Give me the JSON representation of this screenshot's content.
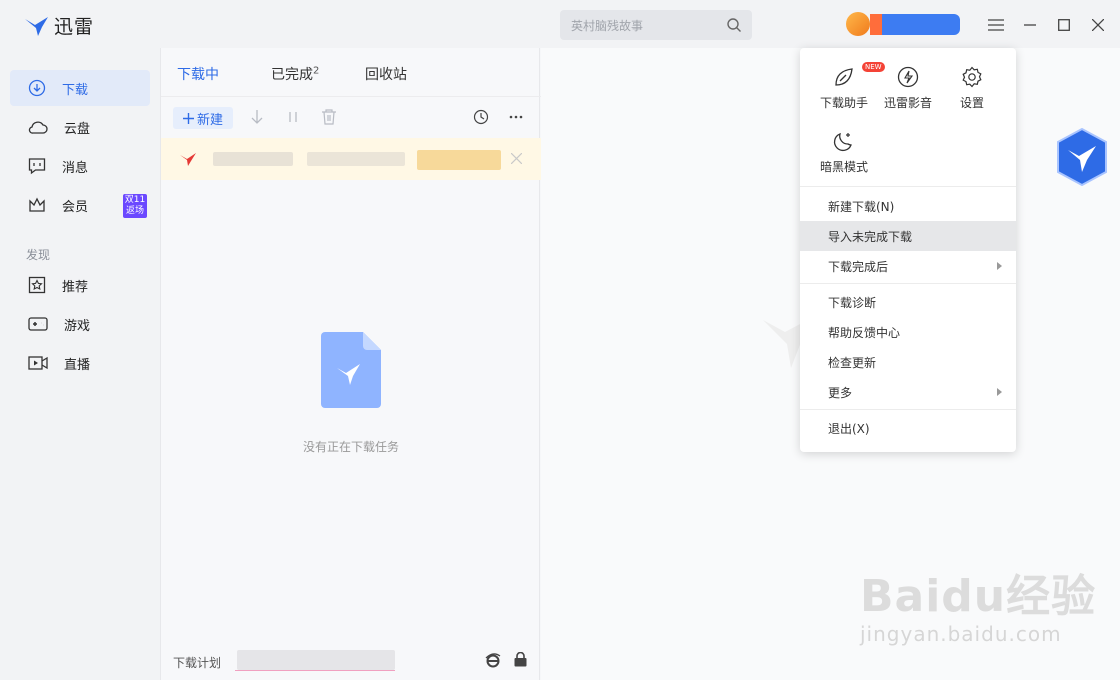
{
  "app": {
    "name": "迅雷"
  },
  "search": {
    "placeholder": "英村脑残故事"
  },
  "sidebar": {
    "items": [
      {
        "label": "下载",
        "icon": "download-circle-icon"
      },
      {
        "label": "云盘",
        "icon": "cloud-icon"
      },
      {
        "label": "消息",
        "icon": "message-icon"
      },
      {
        "label": "会员",
        "icon": "crown-icon"
      }
    ],
    "badge": "双11 返场",
    "section": "发现",
    "discover": [
      {
        "label": "推荐",
        "icon": "star-icon"
      },
      {
        "label": "游戏",
        "icon": "gamepad-icon"
      },
      {
        "label": "直播",
        "icon": "video-icon"
      }
    ]
  },
  "tabs": [
    {
      "label": "下载中"
    },
    {
      "label": "已完成",
      "count": "2"
    },
    {
      "label": "回收站"
    }
  ],
  "toolbar": {
    "new_label": "新建"
  },
  "list": {
    "empty_text": "没有正在下载任务"
  },
  "footer": {
    "plan_label": "下载计划"
  },
  "menu": {
    "quick": [
      {
        "label": "下载助手",
        "icon": "download-assistant-icon",
        "tag": "NEW"
      },
      {
        "label": "迅雷影音",
        "icon": "player-icon"
      },
      {
        "label": "设置",
        "icon": "settings-icon"
      },
      {
        "label": "暗黑模式",
        "icon": "moon-icon"
      }
    ],
    "items": [
      {
        "label": "新建下载(N)"
      },
      {
        "label": "导入未完成下载"
      },
      {
        "label": "下载完成后"
      },
      {
        "label": "下载诊断"
      },
      {
        "label": "帮助反馈中心"
      },
      {
        "label": "检查更新"
      },
      {
        "label": "更多"
      },
      {
        "label": "退出(X)"
      }
    ]
  },
  "watermark": {
    "brand": "Baidu经验",
    "url": "jingyan.baidu.com"
  },
  "colors": {
    "accent": "#2e6be6",
    "highlight_row": "#fff8e5",
    "badge": "#6b48ff"
  }
}
